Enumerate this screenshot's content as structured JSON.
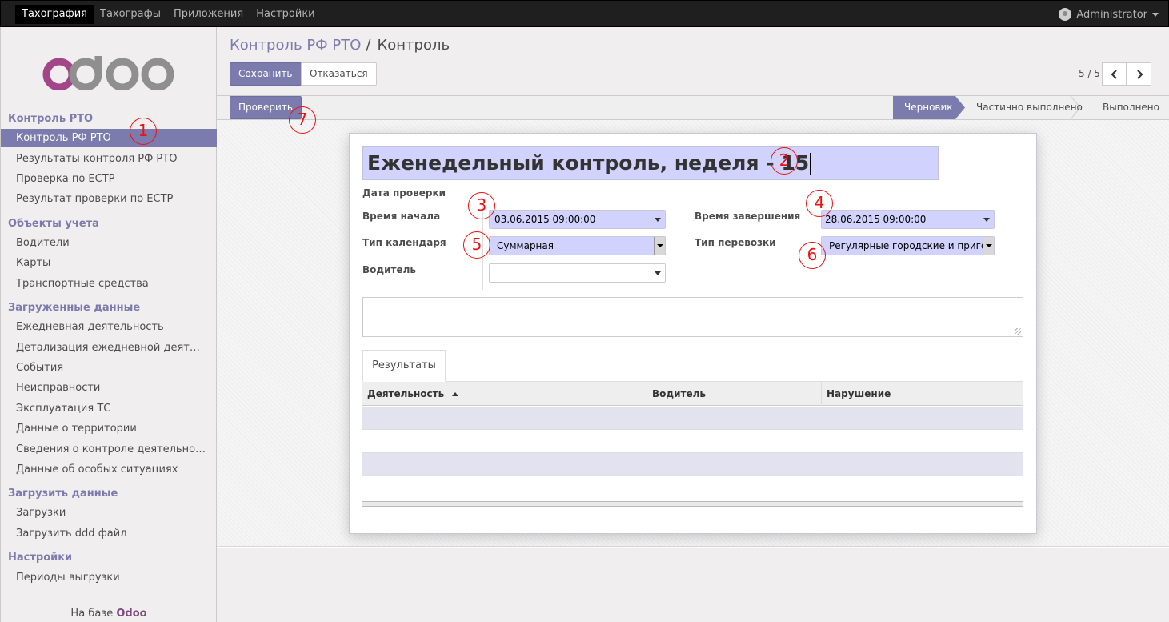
{
  "topbar": {
    "menu": [
      "Тахография",
      "Тахографы",
      "Приложения",
      "Настройки"
    ],
    "user": "Administrator"
  },
  "sidebar": {
    "sections": [
      {
        "title": "Контроль РТО",
        "items": [
          "Контроль РФ РТО",
          "Результаты контроля РФ РТО",
          "Проверка по ЕСТР",
          "Результат проверки по ЕСТР"
        ]
      },
      {
        "title": "Объекты учета",
        "items": [
          "Водители",
          "Карты",
          "Транспортные средства"
        ]
      },
      {
        "title": "Загруженные данные",
        "items": [
          "Ежедневная деятельность",
          "Детализация ежедневной деят…",
          "События",
          "Неисправности",
          "Эксплуатация ТС",
          "Данные о территории",
          "Сведения о контроле деятельно…",
          "Данные об особых ситуациях"
        ]
      },
      {
        "title": "Загрузить данные",
        "items": [
          "Загрузки",
          "Загрузить ddd файл"
        ]
      },
      {
        "title": "Настройки",
        "items": [
          "Периоды выгрузки"
        ]
      }
    ],
    "powered_prefix": "На базе",
    "powered_brand": "Odoo"
  },
  "breadcrumb": {
    "parent": "Контроль РФ РТО",
    "separator": "/",
    "current": "Контроль"
  },
  "buttons": {
    "save": "Сохранить",
    "discard": "Отказаться",
    "check": "Проверить"
  },
  "pager": {
    "value": "5 / 5"
  },
  "statusbar": {
    "stages": [
      "Черновик",
      "Частично выполнено",
      "Выполнено"
    ],
    "current": "Черновик"
  },
  "form": {
    "title": "Еженедельный контроль, неделя - 15",
    "section_label": "Дата проверки",
    "start_label": "Время начала",
    "start_value": "03.06.2015 09:00:00",
    "end_label": "Время завершения",
    "end_value": "28.06.2015 09:00:00",
    "calendar_label": "Тип календаря",
    "calendar_value": "Суммарная",
    "transport_label": "Тип перевозки",
    "transport_value": "Регулярные городские и приго",
    "driver_label": "Водитель",
    "driver_value": ""
  },
  "tabs": [
    "Результаты"
  ],
  "table": {
    "columns": [
      "Деятельность",
      "Водитель",
      "Нарушение"
    ]
  },
  "annotations": [
    "1",
    "2",
    "3",
    "4",
    "5",
    "6",
    "7"
  ],
  "colors": {
    "brand": "#7c7bad",
    "required_field": "#d2d2ff",
    "annotation": "#e11111"
  }
}
